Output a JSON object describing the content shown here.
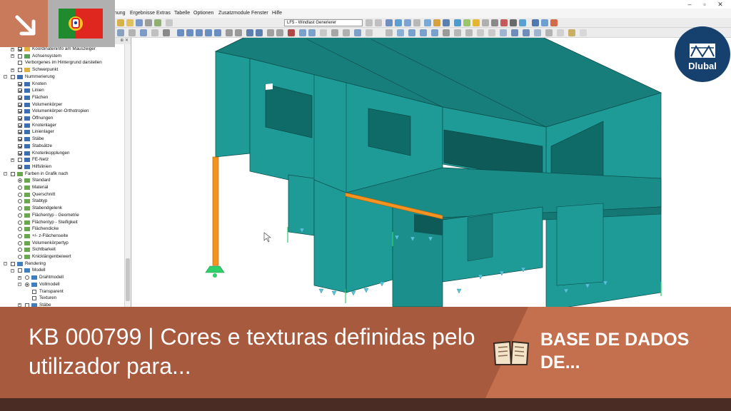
{
  "menu": {
    "items": [
      "nung",
      "Ergebnisse",
      "Extras",
      "Tabelle",
      "Optionen",
      "Zusatzmodule",
      "Fenster",
      "Hilfe"
    ]
  },
  "toolbar": {
    "load_case": "LF5 - Windlast Generierer"
  },
  "navigator": {
    "rows": [
      {
        "label": "Koordinateninfo am Mauszeiger",
        "level": 1,
        "ctrl": "chk",
        "state": true,
        "exp": "+",
        "icon": "grid-icon"
      },
      {
        "label": "Achsensystem",
        "level": 1,
        "ctrl": "chk",
        "state": false,
        "exp": "+",
        "icon": "axis-icon"
      },
      {
        "label": "Verborgenes im Hintergrund darstellen",
        "level": 1,
        "ctrl": "chk",
        "state": false,
        "exp": "",
        "icon": ""
      },
      {
        "label": "Schwerpunkt",
        "level": 1,
        "ctrl": "chk",
        "state": false,
        "exp": "+",
        "icon": "grid-icon"
      },
      {
        "label": "Nummerierung",
        "level": 0,
        "ctrl": "chk",
        "state": false,
        "exp": "-",
        "icon": "number-icon"
      },
      {
        "label": "Knoten",
        "level": 1,
        "ctrl": "chk",
        "state": true,
        "exp": "",
        "icon": "number-icon"
      },
      {
        "label": "Linien",
        "level": 1,
        "ctrl": "chk",
        "state": true,
        "exp": "",
        "icon": "number-icon"
      },
      {
        "label": "Flächen",
        "level": 1,
        "ctrl": "chk",
        "state": true,
        "exp": "",
        "icon": "number-icon"
      },
      {
        "label": "Volumenkörper",
        "level": 1,
        "ctrl": "chk",
        "state": true,
        "exp": "",
        "icon": "number-icon"
      },
      {
        "label": "Volumenkörper-Orthotropien",
        "level": 1,
        "ctrl": "chk",
        "state": true,
        "exp": "",
        "icon": "number-icon"
      },
      {
        "label": "Öffnungen",
        "level": 1,
        "ctrl": "chk",
        "state": true,
        "exp": "",
        "icon": "number-icon"
      },
      {
        "label": "Knotenlager",
        "level": 1,
        "ctrl": "chk",
        "state": true,
        "exp": "",
        "icon": "number-icon"
      },
      {
        "label": "Linienlager",
        "level": 1,
        "ctrl": "chk",
        "state": true,
        "exp": "",
        "icon": "number-icon"
      },
      {
        "label": "Stäbe",
        "level": 1,
        "ctrl": "chk",
        "state": true,
        "exp": "",
        "icon": "number-icon"
      },
      {
        "label": "Stabsätze",
        "level": 1,
        "ctrl": "chk",
        "state": true,
        "exp": "",
        "icon": "number-icon"
      },
      {
        "label": "Knotenkopplungen",
        "level": 1,
        "ctrl": "chk",
        "state": true,
        "exp": "",
        "icon": "number-icon"
      },
      {
        "label": "FE-Netz",
        "level": 1,
        "ctrl": "chk",
        "state": false,
        "exp": "+",
        "icon": "number-icon"
      },
      {
        "label": "Hilfslinien",
        "level": 1,
        "ctrl": "chk",
        "state": true,
        "exp": "",
        "icon": "number-icon"
      },
      {
        "label": "Farben in Grafik nach",
        "level": 0,
        "ctrl": "chk",
        "state": false,
        "exp": "-",
        "icon": "color-icon"
      },
      {
        "label": "Standard",
        "level": 1,
        "ctrl": "rad",
        "state": true,
        "exp": "",
        "icon": "color-icon"
      },
      {
        "label": "Material",
        "level": 1,
        "ctrl": "rad",
        "state": false,
        "exp": "",
        "icon": "color-icon"
      },
      {
        "label": "Querschnitt",
        "level": 1,
        "ctrl": "rad",
        "state": false,
        "exp": "",
        "icon": "color-icon"
      },
      {
        "label": "Stabtyp",
        "level": 1,
        "ctrl": "rad",
        "state": false,
        "exp": "",
        "icon": "color-icon"
      },
      {
        "label": "Stabendgelenk",
        "level": 1,
        "ctrl": "rad",
        "state": false,
        "exp": "",
        "icon": "color-icon"
      },
      {
        "label": "Flächentyp - Geometrie",
        "level": 1,
        "ctrl": "rad",
        "state": false,
        "exp": "",
        "icon": "color-icon"
      },
      {
        "label": "Flächentyp - Steifigkeit",
        "level": 1,
        "ctrl": "rad",
        "state": false,
        "exp": "",
        "icon": "color-icon"
      },
      {
        "label": "Flächendicke",
        "level": 1,
        "ctrl": "rad",
        "state": false,
        "exp": "",
        "icon": "color-icon"
      },
      {
        "label": "+/- z-Flächenseite",
        "level": 1,
        "ctrl": "rad",
        "state": false,
        "exp": "",
        "icon": "color-icon"
      },
      {
        "label": "Volumenkörpertyp",
        "level": 1,
        "ctrl": "rad",
        "state": false,
        "exp": "",
        "icon": "color-icon"
      },
      {
        "label": "Sichtbarkeit",
        "level": 1,
        "ctrl": "rad",
        "state": false,
        "exp": "",
        "icon": "color-icon"
      },
      {
        "label": "Knicklängenbeiwert",
        "level": 1,
        "ctrl": "rad",
        "state": false,
        "exp": "",
        "icon": "color-icon"
      },
      {
        "label": "Rendering",
        "level": 0,
        "ctrl": "chk",
        "state": false,
        "exp": "-",
        "icon": "render-icon"
      },
      {
        "label": "Modell",
        "level": 1,
        "ctrl": "chk",
        "state": false,
        "exp": "-",
        "icon": "render-icon"
      },
      {
        "label": "Drahtmodell",
        "level": 2,
        "ctrl": "rad",
        "state": false,
        "exp": "+",
        "icon": "render-icon"
      },
      {
        "label": "Vollmodell",
        "level": 2,
        "ctrl": "rad",
        "state": true,
        "exp": "-",
        "icon": "render-icon"
      },
      {
        "label": "Transparent",
        "level": 3,
        "ctrl": "chk",
        "state": false,
        "exp": "",
        "icon": ""
      },
      {
        "label": "Texturen",
        "level": 3,
        "ctrl": "chk",
        "state": false,
        "exp": "",
        "icon": ""
      },
      {
        "label": "Stäbe",
        "level": 2,
        "ctrl": "chk",
        "state": false,
        "exp": "+",
        "icon": "render-icon"
      }
    ]
  },
  "overlay": {
    "brand": "Dlubal",
    "flag": "portugal-flag"
  },
  "banner": {
    "title": "KB 000799 | Cores e texturas definidas pelo utilizador para...",
    "category": "BASE DE DADOS DE...",
    "icon": "open-book-icon"
  },
  "colors": {
    "surface": "#1e9b97",
    "surface_top": "#177e7b",
    "member": "#f39422",
    "support": "#2fd06a",
    "banner_left": "#a85a3f",
    "banner_right": "#c4704f",
    "banner_strip": "#4a2c24",
    "arrow_badge": "#c97a5a",
    "dlubal_blue": "#16406d"
  }
}
